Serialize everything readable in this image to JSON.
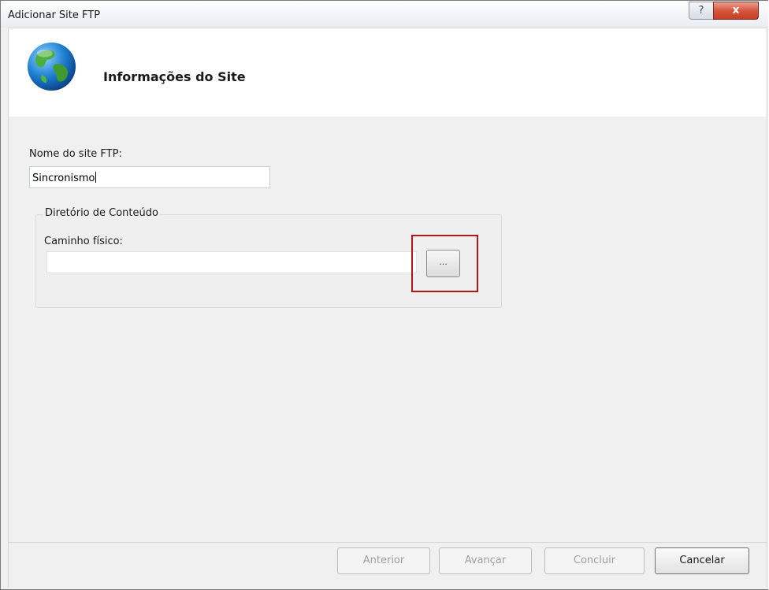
{
  "window": {
    "title": "Adicionar Site FTP",
    "help_glyph": "?",
    "close_glyph": "x"
  },
  "header": {
    "heading": "Informações do Site",
    "icon": "globe-icon"
  },
  "form": {
    "site_name_label": "Nome do site FTP:",
    "site_name_value": "Sincronismo",
    "content_group_label": "Diretório de Conteúdo",
    "physical_path_label": "Caminho físico:",
    "physical_path_value": "",
    "browse_label": "..."
  },
  "footer": {
    "previous_label": "Anterior",
    "next_label": "Avançar",
    "finish_label": "Concluir",
    "cancel_label": "Cancelar"
  },
  "colors": {
    "highlight_border": "#b01818",
    "close_button": "#c63e25"
  }
}
